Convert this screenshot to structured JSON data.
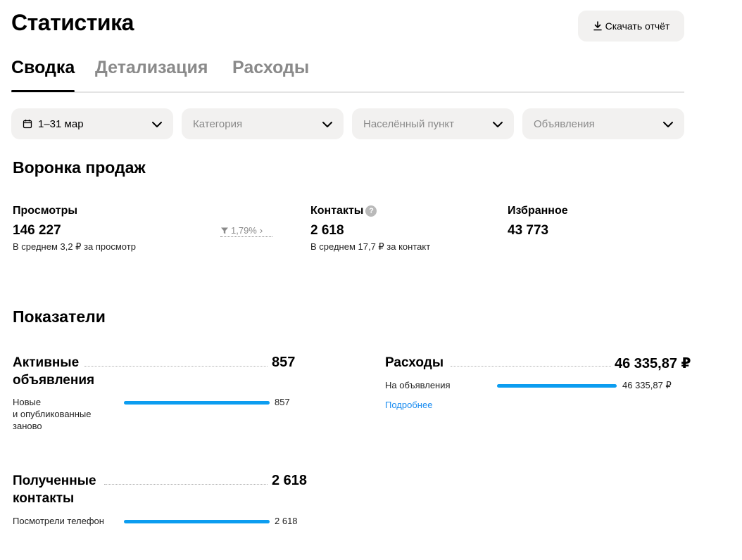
{
  "header": {
    "title": "Статистика",
    "download_label": "Скачать отчёт"
  },
  "tabs": [
    {
      "label": "Сводка",
      "active": true
    },
    {
      "label": "Детализация",
      "active": false
    },
    {
      "label": "Расходы",
      "active": false
    }
  ],
  "filters": {
    "period": "1–31 мар",
    "category_placeholder": "Категория",
    "location_placeholder": "Населённый пункт",
    "ads_placeholder": "Объявления"
  },
  "funnel": {
    "title": "Воронка продаж",
    "views": {
      "label": "Просмотры",
      "value": "146 227",
      "sub": "В среднем 3,2 ₽ за просмотр"
    },
    "conversion": "1,79%",
    "contacts": {
      "label": "Контакты",
      "help": "?",
      "value": "2 618",
      "sub": "В среднем 17,7 ₽ за контакт"
    },
    "favorites": {
      "label": "Избранное",
      "value": "43 773"
    }
  },
  "indicators": {
    "title": "Показатели",
    "active_ads": {
      "title_line1": "Активные",
      "title_line2": "объявления",
      "value": "857",
      "rows": [
        {
          "label_lines": [
            "Новые",
            "и опубликованные",
            "заново"
          ],
          "value": "857",
          "fraction": 1.0
        }
      ]
    },
    "contacts_received": {
      "title_line1": "Полученные",
      "title_line2": "контакты",
      "value": "2 618",
      "rows": [
        {
          "label": "Посмотрели телефон",
          "value": "2 618",
          "fraction": 1.0
        }
      ]
    },
    "expenses": {
      "title": "Расходы",
      "value": "46 335,87 ₽",
      "rows": [
        {
          "label": "На объявления",
          "value": "46 335,87 ₽",
          "fraction": 1.0
        }
      ],
      "more_link": "Подробнее"
    }
  },
  "colors": {
    "accent_bar": "#0c9df0",
    "link": "#1a8cf0",
    "muted": "#8a8a8a",
    "surface": "#f2f1f0"
  },
  "icons": {
    "download": "download-icon",
    "calendar": "calendar-icon",
    "chevron": "chevron-down-icon",
    "funnel": "funnel-icon",
    "help": "help-icon"
  }
}
